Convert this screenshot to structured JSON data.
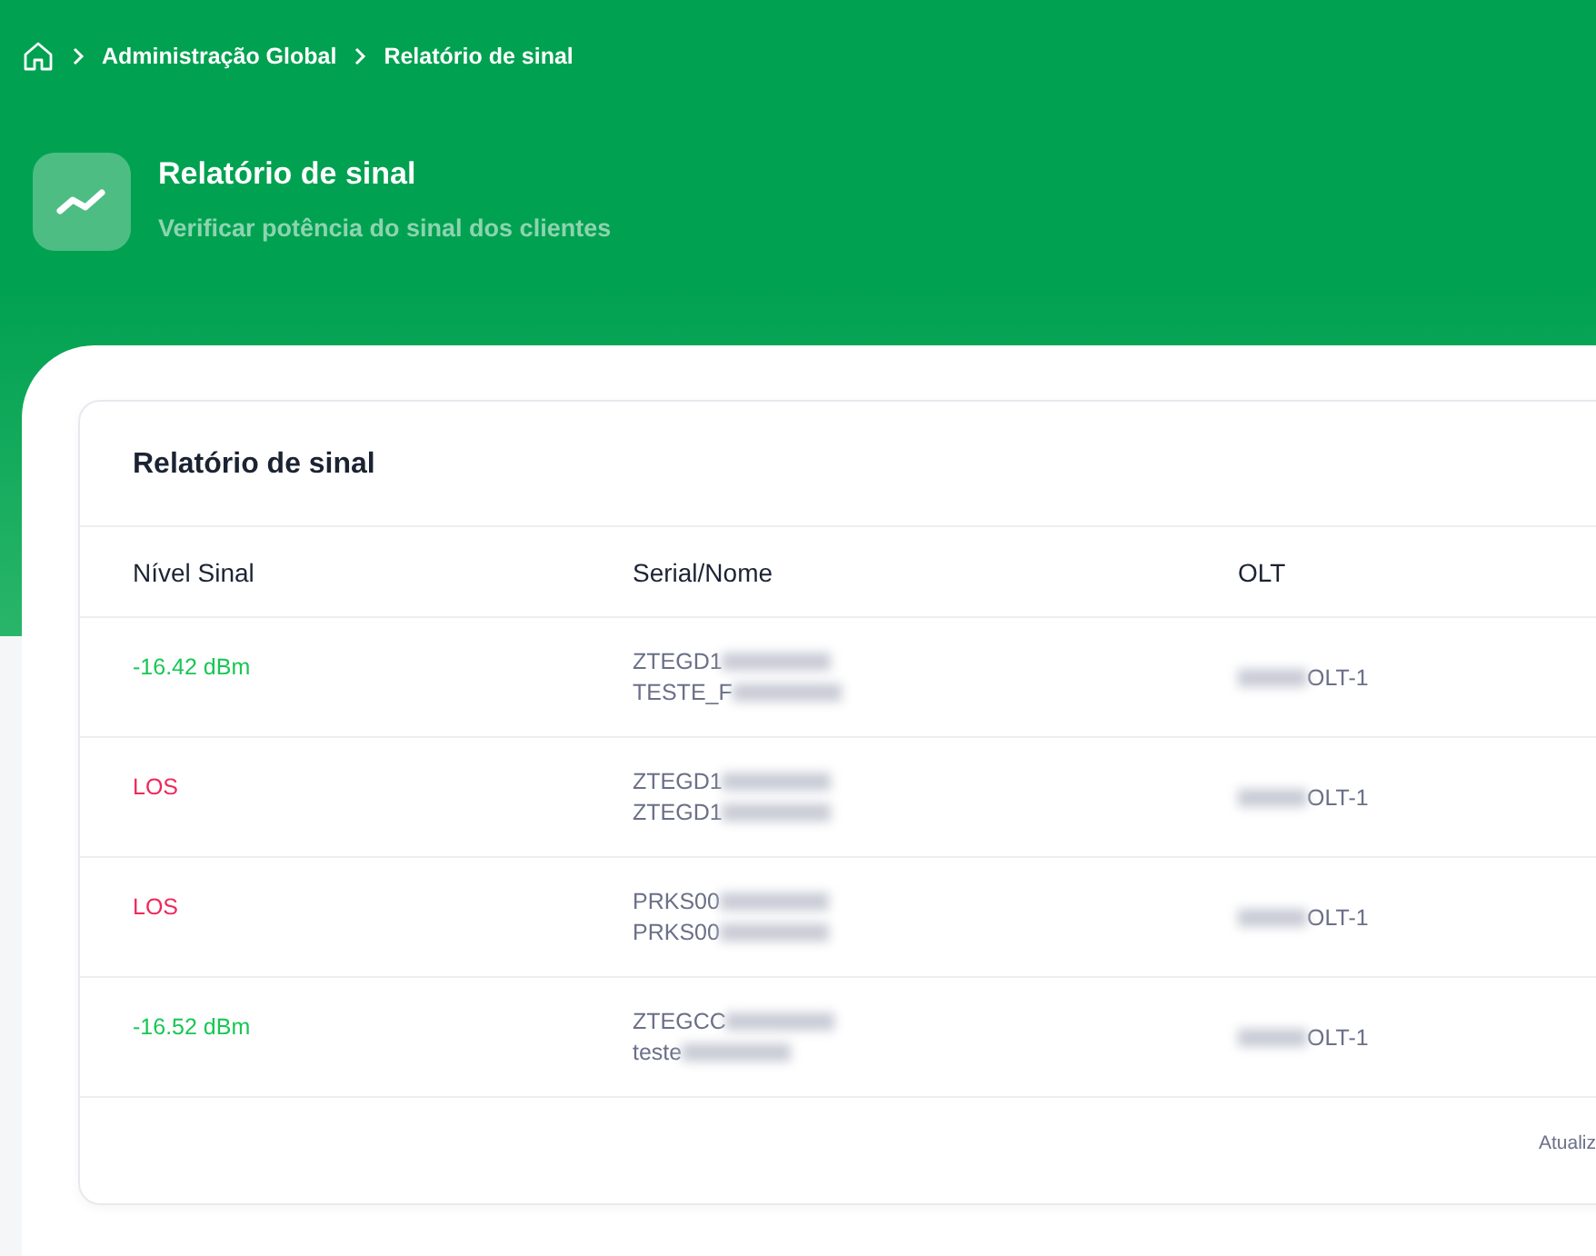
{
  "breadcrumb": [
    "Administração Global",
    "Relatório de sinal"
  ],
  "header": {
    "title": "Relatório de sinal",
    "subtitle": "Verificar potência do sinal dos clientes"
  },
  "card": {
    "title": "Relatório de sinal",
    "table": {
      "columns": [
        "Nível Sinal",
        "Serial/Nome",
        "OLT"
      ],
      "rows": [
        {
          "signal": "-16.42 dBm",
          "color": "#17c653",
          "serial": "ZTEGD1",
          "name": "TESTE_F",
          "olt": "OLT-1"
        },
        {
          "signal": "LOS",
          "color": "#f1285a",
          "serial": "ZTEGD1",
          "name": "ZTEGD1",
          "olt": "OLT-1"
        },
        {
          "signal": "LOS",
          "color": "#f1285a",
          "serial": "PRKS00",
          "name": "PRKS00",
          "olt": "OLT-1"
        },
        {
          "signal": "-16.52 dBm",
          "color": "#17c653",
          "serial": "ZTEGCC",
          "name": "teste",
          "olt": "OLT-1"
        }
      ]
    },
    "footer": "Atualiz"
  }
}
